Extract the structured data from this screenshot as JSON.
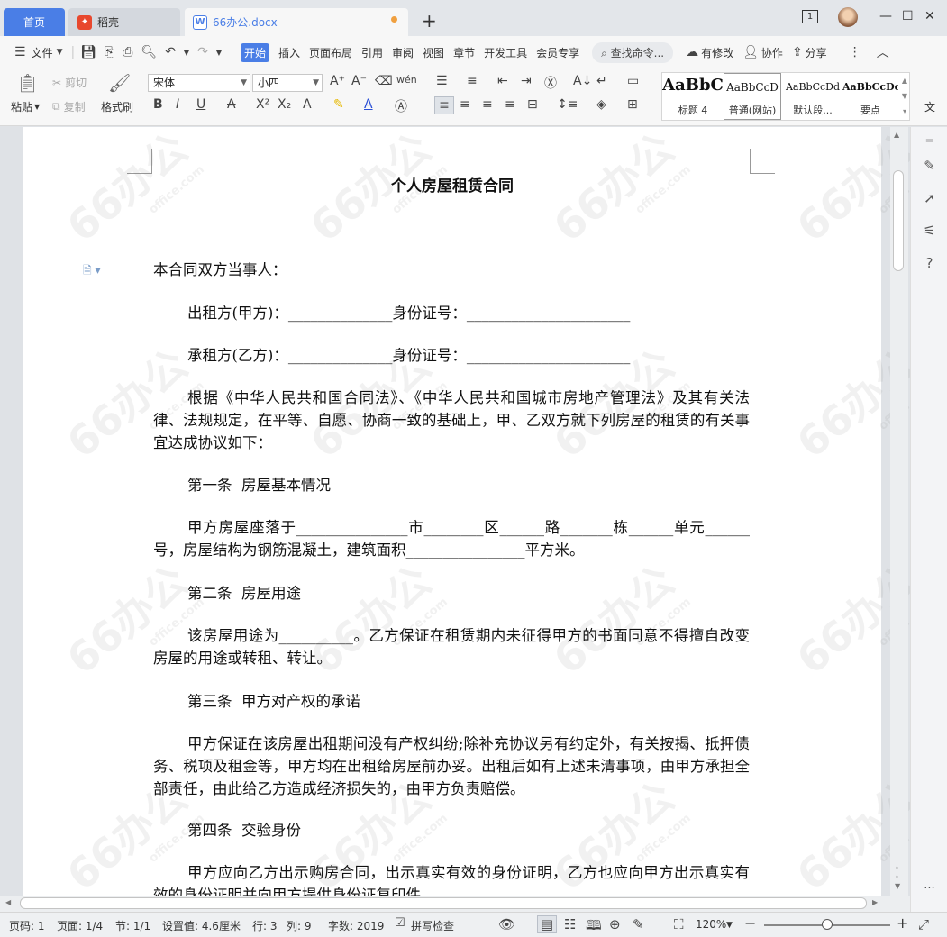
{
  "tabs": {
    "home": "首页",
    "daoke": "稻壳",
    "document": "66办公.docx"
  },
  "window": {
    "page_counter": "1"
  },
  "menu": {
    "file": "文件",
    "items": [
      "开始",
      "插入",
      "页面布局",
      "引用",
      "审阅",
      "视图",
      "章节",
      "开发工具",
      "会员专享"
    ],
    "search_placeholder": "查找命令...",
    "right": {
      "changes": "有修改",
      "collab": "协作",
      "share": "分享"
    }
  },
  "ribbon": {
    "paste": "粘贴",
    "cut": "剪切",
    "copy": "复制",
    "format_painter": "格式刷",
    "font_name": "宋体",
    "font_size": "小四",
    "styles": [
      {
        "sample": "AaBbC",
        "name": "标题 4"
      },
      {
        "sample": "AaBbCcD",
        "name": "普通(网站)"
      },
      {
        "sample": "AaBbCcDd",
        "name": "默认段..."
      },
      {
        "sample": "AaBbCcDc",
        "name": "要点"
      }
    ],
    "more_label": "文"
  },
  "document": {
    "title": "个人房屋租赁合同",
    "paragraphs": [
      "本合同双方当事人：",
      "出租方(甲方)：______________身份证号：______________________",
      "承租方(乙方)：______________身份证号：______________________",
      "根据《中华人民共和国合同法》、《中华人民共和国城市房地产管理法》及其有关法律、法规规定，在平等、自愿、协商一致的基础上，甲、乙双方就下列房屋的租赁的有关事宜达成协议如下：",
      "第一条  房屋基本情况",
      "甲方房屋座落于_______________市________区______路_______栋______单元______号，房屋结构为钢筋混凝土，建筑面积________________平方米。",
      "第二条  房屋用途",
      "该房屋用途为__________。乙方保证在租赁期内未征得甲方的书面同意不得擅自改变房屋的用途或转租、转让。",
      "第三条  甲方对产权的承诺",
      "甲方保证在该房屋出租期间没有产权纠纷;除补充协议另有约定外，有关按揭、抵押债务、税项及租金等，甲方均在出租给房屋前办妥。出租后如有上述未清事项，由甲方承担全部责任，由此给乙方造成经济损失的，由甲方负责赔偿。",
      "第四条  交验身份",
      "甲方应向乙方出示购房合同，出示真实有效的身份证明，乙方也应向甲方出示真实有效的身份证明并向甲方提供身份证复印件。"
    ]
  },
  "watermark": {
    "big": "66办公",
    "small": "office.com"
  },
  "status": {
    "page_num": "页码: 1",
    "pages": "页面: 1/4",
    "section": "节: 1/1",
    "position": "设置值: 4.6厘米",
    "row": "行: 3",
    "col": "列: 9",
    "words": "字数: 2019",
    "spell": "拼写检查",
    "zoom": "120%"
  }
}
